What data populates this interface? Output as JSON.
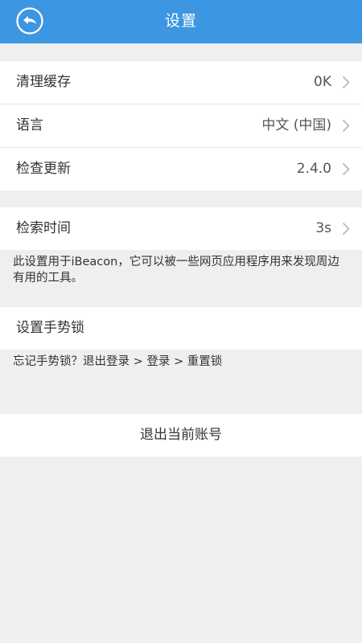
{
  "header": {
    "title": "设置",
    "back_icon": "back-arrow-icon",
    "background_color": "#3d96e2"
  },
  "general_group": [
    {
      "label": "清理缓存",
      "value": "0K"
    },
    {
      "label": "语言",
      "value": "中文 (中国)"
    },
    {
      "label": "检查更新",
      "value": "2.4.0"
    }
  ],
  "search_group": {
    "label": "检索时间",
    "value": "3s",
    "note": "此设置用于iBeacon，它可以被一些网页应用程序用来发现周边有用的工具。"
  },
  "gesture_group": {
    "label": "设置手势锁",
    "note": "忘记手势锁？退出登录 > 登录 > 重置锁"
  },
  "logout": {
    "label": "退出当前账号"
  }
}
